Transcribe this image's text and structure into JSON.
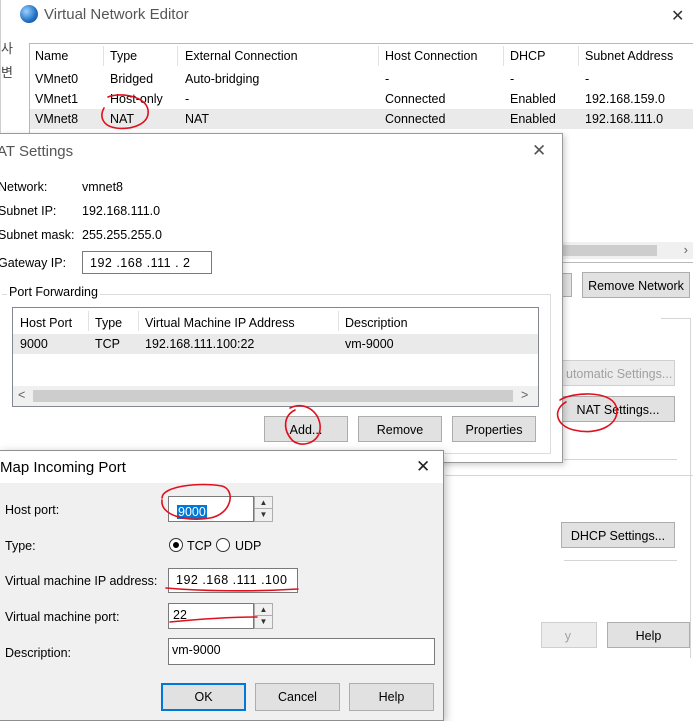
{
  "vne": {
    "title": "Virtual Network Editor",
    "close": "✕",
    "korean_left_1": "사",
    "korean_left_2": "변",
    "columns": [
      "Name",
      "Type",
      "External Connection",
      "Host Connection",
      "DHCP",
      "Subnet Address"
    ],
    "rows": [
      {
        "name": "VMnet0",
        "type": "Bridged",
        "external": "Auto-bridging",
        "host": "-",
        "dhcp": "-",
        "subnet": "-"
      },
      {
        "name": "VMnet1",
        "type": "Host-only",
        "external": "-",
        "host": "Connected",
        "dhcp": "Enabled",
        "subnet": "192.168.159.0"
      },
      {
        "name": "VMnet8",
        "type": "NAT",
        "external": "NAT",
        "host": "Connected",
        "dhcp": "Enabled",
        "subnet": "192.168.111.0"
      }
    ],
    "scroll_right": "›",
    "remove_network": "Remove Network",
    "automatic_settings": "utomatic Settings...",
    "nat_settings": "NAT Settings...",
    "dhcp_settings": "DHCP Settings...",
    "apply_partial": "y",
    "help": "Help"
  },
  "nat": {
    "title": "AT Settings",
    "close": "✕",
    "network_label": "Network:",
    "network_value": "vmnet8",
    "subnet_ip_label": "Subnet IP:",
    "subnet_ip_value": "192.168.111.0",
    "subnet_mask_label": "Subnet mask:",
    "subnet_mask_value": "255.255.255.0",
    "gateway_label": "Gateway IP:",
    "gateway_value": "192 .168 .111 .  2",
    "port_forwarding_label": "Port Forwarding",
    "columns": [
      "Host Port",
      "Type",
      "Virtual Machine IP Address",
      "Description"
    ],
    "rows": [
      {
        "host_port": "9000",
        "type": "TCP",
        "vm_ip": "192.168.111.100:22",
        "description": "vm-9000"
      }
    ],
    "scroll_left": "<",
    "scroll_right": ">",
    "add": "Add...",
    "remove": "Remove",
    "properties": "Properties"
  },
  "map": {
    "title": "Map Incoming Port",
    "close": "✕",
    "host_port_label": "Host port:",
    "host_port_value": "9000",
    "type_label": "Type:",
    "tcp": "TCP",
    "udp": "UDP",
    "type_selected": "TCP",
    "vm_ip_label": "Virtual machine IP address:",
    "vm_ip_value": "192 .168 .111 .100",
    "vm_port_label": "Virtual machine port:",
    "vm_port_value": "22",
    "description_label": "Description:",
    "description_value": "vm-9000",
    "ok": "OK",
    "cancel": "Cancel",
    "help": "Help"
  },
  "colors": {
    "accent": "#0078d7",
    "annotation": "#e0101e"
  }
}
